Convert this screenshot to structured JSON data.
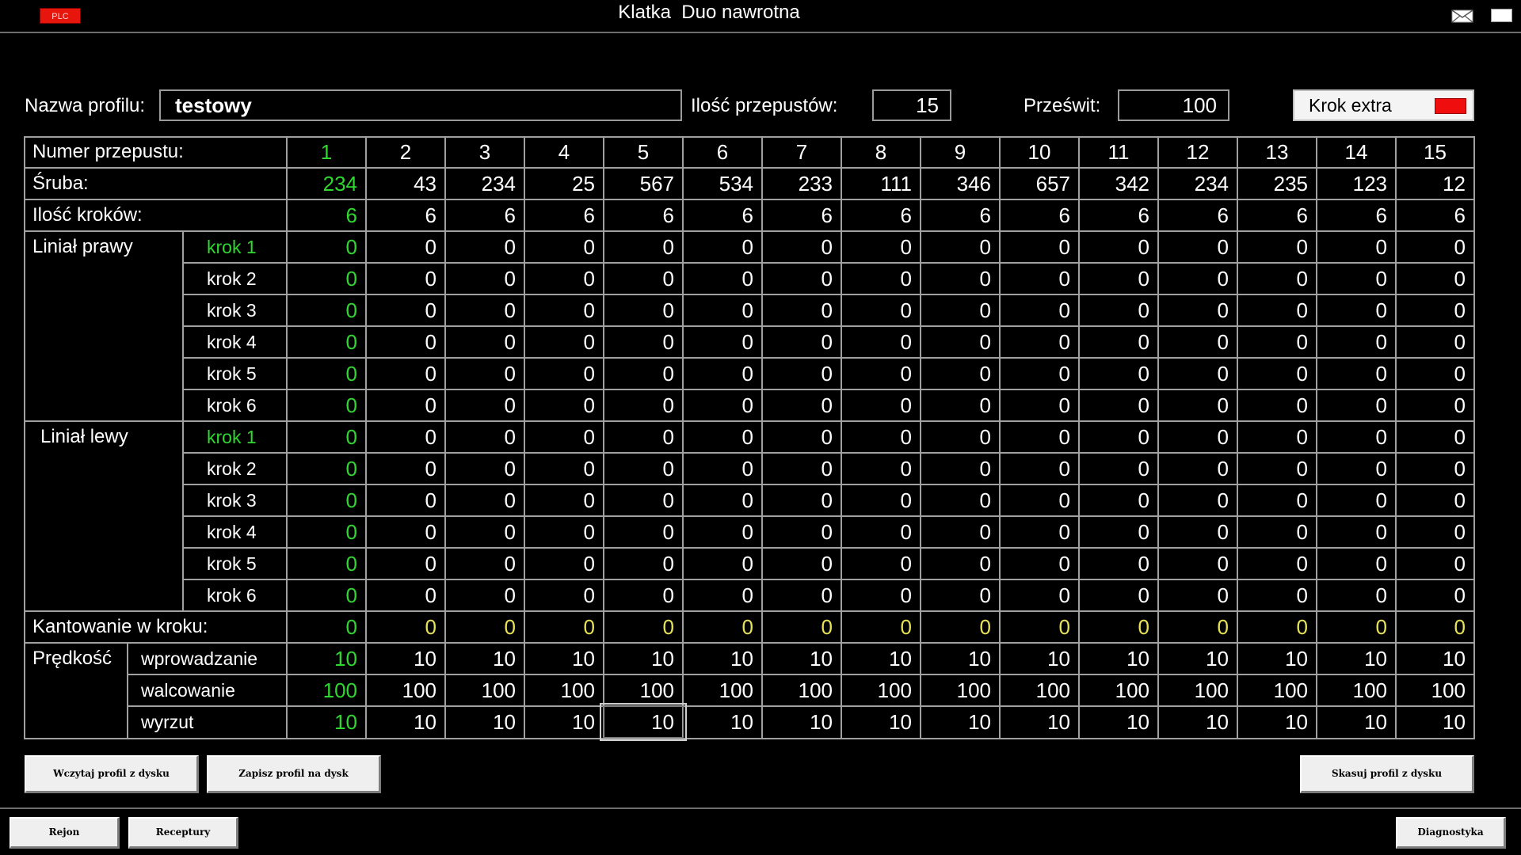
{
  "window": {
    "plc_badge": "PLC",
    "title": "Klatka  Duo nawrotna",
    "icons": [
      "mail-icon",
      "window-icon"
    ]
  },
  "header": {
    "profile_name_label": "Nazwa profilu:",
    "profile_name_value": "testowy",
    "pass_count_label": "Ilość przepustów:",
    "pass_count_value": "15",
    "clearance_label": "Prześwit:",
    "clearance_value": "100",
    "krok_extra_label": "Krok extra",
    "krok_extra_indicator_color": "#f00d0d"
  },
  "table": {
    "numer_label": "Numer przepustu:",
    "sruba_label": "Śruba:",
    "ilosc_krokow_label": "Ilość kroków:",
    "linial_prawy_label": "Liniał prawy",
    "linial_lewy_label": "Liniał lewy",
    "step_labels": [
      "krok 1",
      "krok 2",
      "krok 3",
      "krok 4",
      "krok 5",
      "krok 6"
    ],
    "kantowanie_label": "Kantowanie w kroku:",
    "predkosc_label": "Prędkość",
    "speed_labels": [
      "wprowadzanie",
      "walcowanie",
      "wyrzut"
    ],
    "pass_numbers": [
      "1",
      "2",
      "3",
      "4",
      "5",
      "6",
      "7",
      "8",
      "9",
      "10",
      "11",
      "12",
      "13",
      "14",
      "15"
    ],
    "sruba": [
      "234",
      "43",
      "234",
      "25",
      "567",
      "534",
      "233",
      "111",
      "346",
      "657",
      "342",
      "234",
      "235",
      "123",
      "12"
    ],
    "ilosc_krokow": [
      "6",
      "6",
      "6",
      "6",
      "6",
      "6",
      "6",
      "6",
      "6",
      "6",
      "6",
      "6",
      "6",
      "6",
      "6"
    ],
    "linial_prawy": [
      [
        "0",
        "0",
        "0",
        "0",
        "0",
        "0",
        "0",
        "0",
        "0",
        "0",
        "0",
        "0",
        "0",
        "0",
        "0"
      ],
      [
        "0",
        "0",
        "0",
        "0",
        "0",
        "0",
        "0",
        "0",
        "0",
        "0",
        "0",
        "0",
        "0",
        "0",
        "0"
      ],
      [
        "0",
        "0",
        "0",
        "0",
        "0",
        "0",
        "0",
        "0",
        "0",
        "0",
        "0",
        "0",
        "0",
        "0",
        "0"
      ],
      [
        "0",
        "0",
        "0",
        "0",
        "0",
        "0",
        "0",
        "0",
        "0",
        "0",
        "0",
        "0",
        "0",
        "0",
        "0"
      ],
      [
        "0",
        "0",
        "0",
        "0",
        "0",
        "0",
        "0",
        "0",
        "0",
        "0",
        "0",
        "0",
        "0",
        "0",
        "0"
      ],
      [
        "0",
        "0",
        "0",
        "0",
        "0",
        "0",
        "0",
        "0",
        "0",
        "0",
        "0",
        "0",
        "0",
        "0",
        "0"
      ]
    ],
    "linial_lewy": [
      [
        "0",
        "0",
        "0",
        "0",
        "0",
        "0",
        "0",
        "0",
        "0",
        "0",
        "0",
        "0",
        "0",
        "0",
        "0"
      ],
      [
        "0",
        "0",
        "0",
        "0",
        "0",
        "0",
        "0",
        "0",
        "0",
        "0",
        "0",
        "0",
        "0",
        "0",
        "0"
      ],
      [
        "0",
        "0",
        "0",
        "0",
        "0",
        "0",
        "0",
        "0",
        "0",
        "0",
        "0",
        "0",
        "0",
        "0",
        "0"
      ],
      [
        "0",
        "0",
        "0",
        "0",
        "0",
        "0",
        "0",
        "0",
        "0",
        "0",
        "0",
        "0",
        "0",
        "0",
        "0"
      ],
      [
        "0",
        "0",
        "0",
        "0",
        "0",
        "0",
        "0",
        "0",
        "0",
        "0",
        "0",
        "0",
        "0",
        "0",
        "0"
      ],
      [
        "0",
        "0",
        "0",
        "0",
        "0",
        "0",
        "0",
        "0",
        "0",
        "0",
        "0",
        "0",
        "0",
        "0",
        "0"
      ]
    ],
    "kantowanie": [
      "0",
      "0",
      "0",
      "0",
      "0",
      "0",
      "0",
      "0",
      "0",
      "0",
      "0",
      "0",
      "0",
      "0",
      "0"
    ],
    "predkosc": [
      [
        "10",
        "10",
        "10",
        "10",
        "10",
        "10",
        "10",
        "10",
        "10",
        "10",
        "10",
        "10",
        "10",
        "10",
        "10"
      ],
      [
        "100",
        "100",
        "100",
        "100",
        "100",
        "100",
        "100",
        "100",
        "100",
        "100",
        "100",
        "100",
        "100",
        "100",
        "100"
      ],
      [
        "10",
        "10",
        "10",
        "10",
        "10",
        "10",
        "10",
        "10",
        "10",
        "10",
        "10",
        "10",
        "10",
        "10",
        "10"
      ]
    ],
    "active_column_color": "#2fd82f",
    "kantowanie_color": "#e7e356"
  },
  "buttons": {
    "load_profile": "Wczytaj profil z dysku",
    "save_profile": "Zapisz profil na dysk",
    "delete_profile": "Skasuj profil z dysku",
    "rejon": "Rejon",
    "receptury": "Receptury",
    "diagnostyka": "Diagnostyka"
  }
}
